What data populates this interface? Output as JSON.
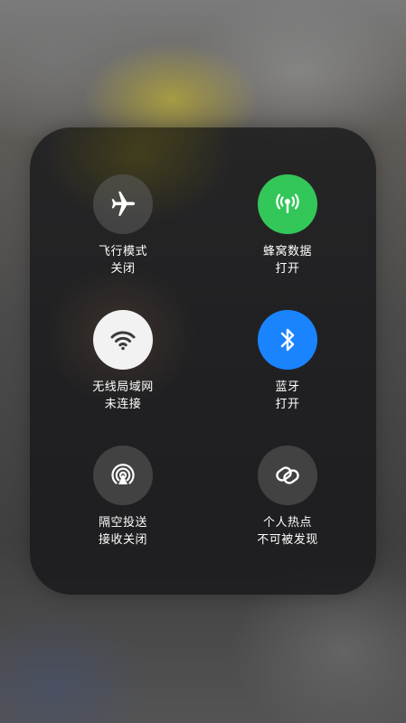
{
  "connectivity_panel": {
    "airplane": {
      "label": "飞行模式",
      "status": "关闭",
      "icon": "airplane-icon",
      "color": "#5f5f5f"
    },
    "cellular": {
      "label": "蜂窝数据",
      "status": "打开",
      "icon": "cellular-antenna-icon",
      "color": "#33c759"
    },
    "wifi": {
      "label": "无线局域网",
      "status": "未连接",
      "icon": "wifi-icon",
      "color": "#f2f2f2"
    },
    "bluetooth": {
      "label": "蓝牙",
      "status": "打开",
      "icon": "bluetooth-icon",
      "color": "#1a84ff"
    },
    "airdrop": {
      "label": "隔空投送",
      "status": "接收关闭",
      "icon": "airdrop-icon",
      "color": "#5f5f5f"
    },
    "hotspot": {
      "label": "个人热点",
      "status": "不可被发现",
      "icon": "hotspot-link-icon",
      "color": "#5f5f5f"
    }
  }
}
